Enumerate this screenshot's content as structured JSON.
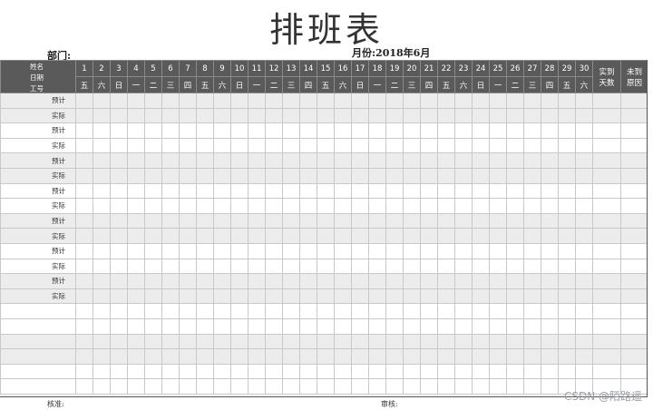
{
  "title": "排班表",
  "department_label": "部门:",
  "month_label": "月份:2018年6月",
  "corner": {
    "name": "姓名",
    "date": "日期",
    "staff_no": "工号"
  },
  "days": [
    "1",
    "2",
    "3",
    "4",
    "5",
    "6",
    "7",
    "8",
    "9",
    "10",
    "11",
    "12",
    "13",
    "14",
    "15",
    "16",
    "17",
    "18",
    "19",
    "20",
    "21",
    "22",
    "23",
    "24",
    "25",
    "26",
    "27",
    "28",
    "29",
    "30"
  ],
  "weekdays": [
    "五",
    "六",
    "日",
    "一",
    "二",
    "三",
    "四",
    "五",
    "六",
    "日",
    "一",
    "二",
    "三",
    "四",
    "五",
    "六",
    "日",
    "一",
    "二",
    "三",
    "四",
    "五",
    "六",
    "日",
    "一",
    "二",
    "三",
    "四",
    "五",
    "六"
  ],
  "col_actual_days": [
    "实到",
    "天数"
  ],
  "col_absent_reason": [
    "未到",
    "原因"
  ],
  "row_labels": [
    "预计",
    "实际",
    "预计",
    "实际",
    "预计",
    "实际",
    "预计",
    "实际",
    "预计",
    "实际",
    "预计",
    "实际",
    "预计",
    "实际"
  ],
  "empty_rows": 6,
  "footer": {
    "approve": "核准:",
    "review": "审核:"
  },
  "watermark": "CSDN @陌路遥"
}
